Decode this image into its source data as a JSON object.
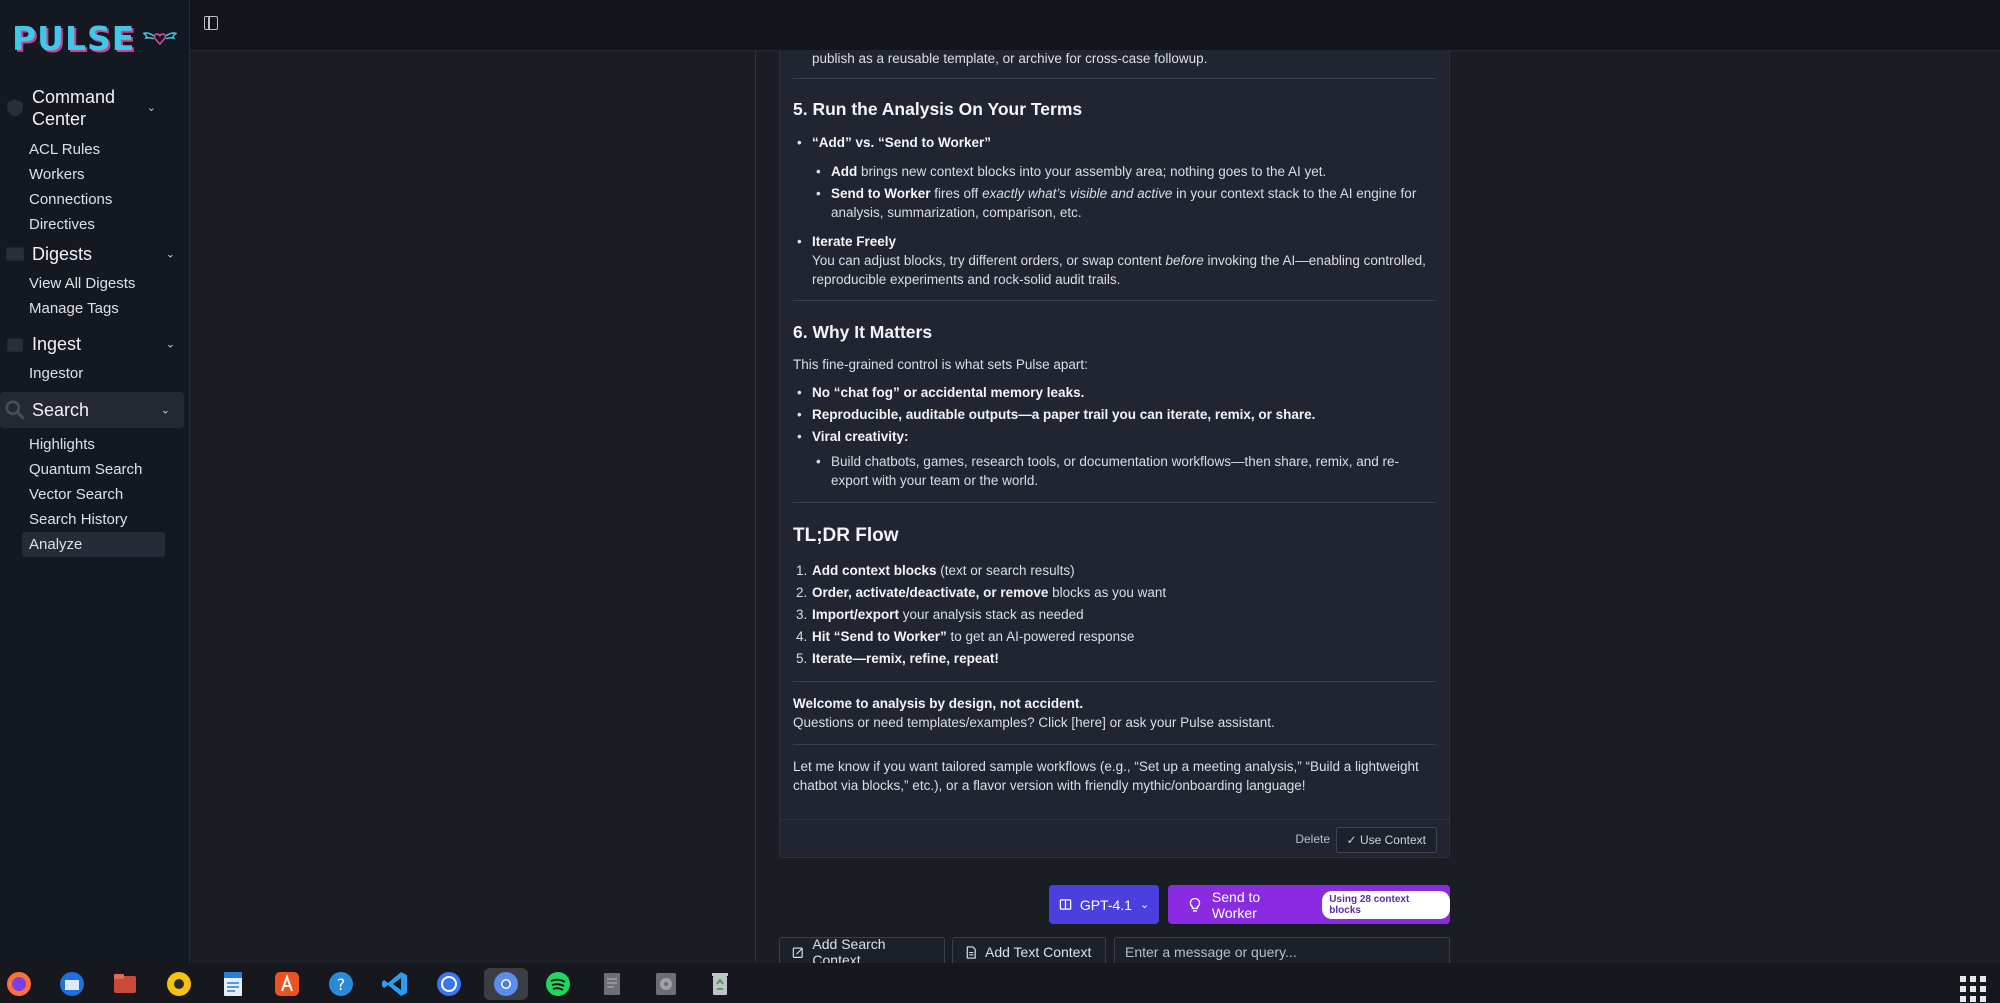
{
  "app": {
    "logo": "PULSE"
  },
  "sidebar": {
    "groups": [
      {
        "label": "Command Center",
        "items": [
          "ACL Rules",
          "Workers",
          "Connections",
          "Directives"
        ]
      },
      {
        "label": "Digests",
        "items": [
          "View All Digests",
          "Manage Tags"
        ]
      },
      {
        "label": "Ingest",
        "items": [
          "Ingestor"
        ]
      },
      {
        "label": "Search",
        "items": [
          "Highlights",
          "Quantum Search",
          "Vector Search",
          "Search History",
          "Analyze"
        ]
      }
    ],
    "current_item": "Analyze"
  },
  "content": {
    "intro_tail": "publish as a reusable template, or archive for cross-case followup.",
    "s5": {
      "title": "5. Run the Analysis On Your Terms",
      "b1_title": "“Add” vs. “Send to Worker”",
      "b1_add_bold": "Add",
      "b1_add_text": " brings new context blocks into your assembly area; nothing goes to the AI yet.",
      "b1_send_bold": "Send to Worker",
      "b1_send_text1": " fires off ",
      "b1_send_em": "exactly what’s visible and active",
      "b1_send_text2": " in your context stack to the AI engine for",
      "b1_send_text3": "analysis, summarization, comparison, etc.",
      "b2_title": "Iterate Freely",
      "b2_text1": "You can adjust blocks, try different orders, or swap content ",
      "b2_em": "before",
      "b2_text2": " invoking the AI—enabling controlled,",
      "b2_text3": "reproducible experiments and rock-solid audit trails."
    },
    "s6": {
      "title": "6. Why It Matters",
      "intro": "This fine-grained control is what sets Pulse apart:",
      "p1": "No “chat fog” or accidental memory leaks.",
      "p2": "Reproducible, auditable outputs—a paper trail you can iterate, remix, or share.",
      "p3": "Viral creativity:",
      "p3_sub1": "Build chatbots, games, research tools, or documentation workflows—then share, remix, and re-",
      "p3_sub2": "export with your team or the world."
    },
    "tldr": {
      "title": "TL;DR Flow",
      "steps": [
        {
          "n": "1.",
          "bold": "Add context blocks",
          "rest": " (text or search results)"
        },
        {
          "n": "2.",
          "bold": "Order, activate/deactivate, or remove",
          "rest": " blocks as you want"
        },
        {
          "n": "3.",
          "bold": "Import/export",
          "rest": " your analysis stack as needed"
        },
        {
          "n": "4.",
          "bold": "Hit “Send to Worker”",
          "rest": " to get an AI-powered response"
        },
        {
          "n": "5.",
          "bold": "Iterate—remix, refine, repeat!",
          "rest": ""
        }
      ]
    },
    "welcome_bold": "Welcome to analysis by design, not accident.",
    "welcome_text": "Questions or need templates/examples? Click [here] or ask your Pulse assistant.",
    "closing1": "Let me know if you want tailored sample workflows (e.g., “Set up a meeting analysis,” “Build a lightweight",
    "closing2": "chatbot via blocks,” etc.), or a flavor version with friendly mythic/onboarding language!",
    "delete_label": "Delete",
    "use_context_label": "Use Context"
  },
  "actions": {
    "model": "GPT-4.1",
    "send_label": "Send to Worker",
    "context_pill": "Using 28 context blocks",
    "add_search": "Add Search Context",
    "add_text": "Add Text Context",
    "input_placeholder": "Enter a message or query..."
  },
  "dock": {
    "apps": [
      "firefox-icon",
      "thunderbird-icon",
      "files-icon",
      "rhythmbox-icon",
      "writer-icon",
      "app-center-icon",
      "help-icon",
      "vscode-icon",
      "signal-icon",
      "chromium-icon",
      "spotify-icon",
      "text-editor-icon",
      "disk-icon",
      "trash-icon"
    ],
    "active": "chromium-icon"
  },
  "colors": {
    "accent_blue": "#4b3fe0",
    "accent_purple": "#8a2be2",
    "logo_cyan": "#3fc9e8",
    "logo_pink": "#d43f8d"
  }
}
